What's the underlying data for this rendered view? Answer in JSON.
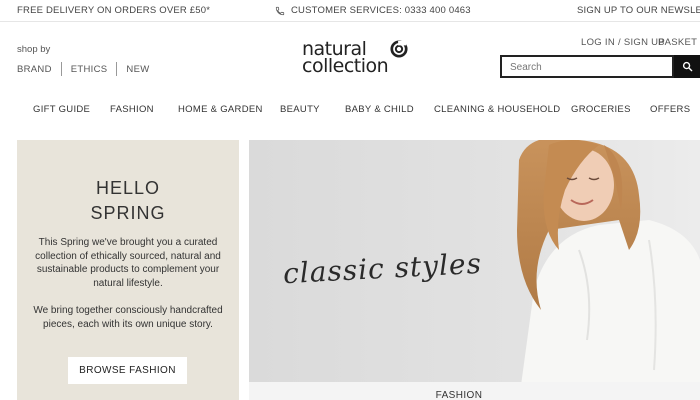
{
  "topbar": {
    "delivery": "FREE DELIVERY ON ORDERS OVER £50*",
    "customer_services": "CUSTOMER SERVICES: 0333 400 0463",
    "newsletter": "SIGN UP TO OUR NEWSLETTER"
  },
  "header": {
    "shop_by_label": "shop by",
    "shop_by_links": [
      "BRAND",
      "ETHICS",
      "NEW"
    ],
    "logo_line1": "natural",
    "logo_line2": "collection",
    "account_link": "LOG IN / SIGN UP",
    "basket_label": "BASKET",
    "basket_count": "[0",
    "search_placeholder": "Search"
  },
  "nav": {
    "items": [
      "GIFT GUIDE",
      "FASHION",
      "HOME & GARDEN",
      "BEAUTY",
      "BABY & CHILD",
      "CLEANING & HOUSEHOLD",
      "GROCERIES",
      "OFFERS"
    ]
  },
  "promo": {
    "title_line1": "HELLO",
    "title_line2": "SPRING",
    "paragraph1": "This Spring we've brought you a curated collection of ethically sourced, natural and sustainable products to complement your natural lifestyle.",
    "paragraph2": "We bring together consciously handcrafted pieces, each with its own unique story.",
    "cta": "BROWSE FASHION"
  },
  "hero": {
    "script_text": "classic styles",
    "caption": "FASHION"
  },
  "colors": {
    "promo_bg": "#e8e4da",
    "hero_bg": "#dcdcdc",
    "search_button": "#111111",
    "text": "#333333"
  }
}
